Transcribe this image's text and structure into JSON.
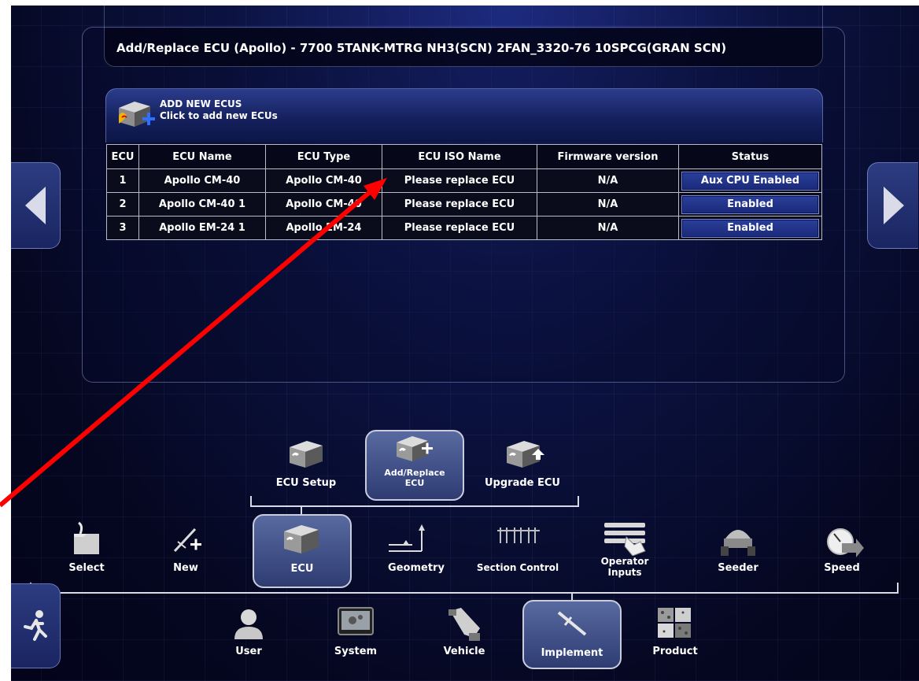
{
  "title": "Add/Replace ECU (Apollo) - 7700 5TANK-MTRG NH3(SCN) 2FAN_3320-76 10SPCG(GRAN SCN)",
  "add_new": {
    "heading": "ADD NEW ECUS",
    "subtext": "Click to add new ECUs"
  },
  "table": {
    "headers": [
      "ECU",
      "ECU Name",
      "ECU Type",
      "ECU ISO Name",
      "Firmware version",
      "Status"
    ],
    "rows": [
      {
        "ecu": "1",
        "name": "Apollo CM-40",
        "type": "Apollo CM-40",
        "iso_name": "Please replace ECU",
        "firmware": "N/A",
        "status": "Aux CPU Enabled"
      },
      {
        "ecu": "2",
        "name": "Apollo CM-40 1",
        "type": "Apollo CM-40",
        "iso_name": "Please replace ECU",
        "firmware": "N/A",
        "status": "Enabled"
      },
      {
        "ecu": "3",
        "name": "Apollo EM-24 1",
        "type": "Apollo EM-24",
        "iso_name": "Please replace ECU",
        "firmware": "N/A",
        "status": "Enabled"
      }
    ]
  },
  "ecu_menu": {
    "items": [
      {
        "label": "ECU Setup",
        "icon": "ecu-icon"
      },
      {
        "label": "Add/Replace ECU",
        "icon": "ecu-add-icon",
        "selected": true
      },
      {
        "label": "Upgrade ECU",
        "icon": "ecu-upgrade-icon"
      }
    ]
  },
  "implement_menu": {
    "items": [
      {
        "label": "Select",
        "icon": "folder-icon"
      },
      {
        "label": "New",
        "icon": "new-implement-icon"
      },
      {
        "label": "ECU",
        "icon": "ecu-icon",
        "selected": true
      },
      {
        "label": "Geometry",
        "icon": "geometry-icon"
      },
      {
        "label": "Section Control",
        "icon": "section-control-icon"
      },
      {
        "label": "Operator Inputs",
        "icon": "operator-inputs-icon"
      },
      {
        "label": "Seeder",
        "icon": "seeder-icon"
      },
      {
        "label": "Speed",
        "icon": "speed-icon"
      }
    ]
  },
  "main_menu": {
    "items": [
      {
        "label": "User",
        "icon": "user-icon"
      },
      {
        "label": "System",
        "icon": "system-icon"
      },
      {
        "label": "Vehicle",
        "icon": "vehicle-icon"
      },
      {
        "label": "Implement",
        "icon": "implement-icon",
        "selected": true
      },
      {
        "label": "Product",
        "icon": "product-icon"
      }
    ]
  },
  "colors": {
    "background": "#0b1240",
    "status_button": "#2b3f9a",
    "annotation_arrow": "#ff0000"
  }
}
